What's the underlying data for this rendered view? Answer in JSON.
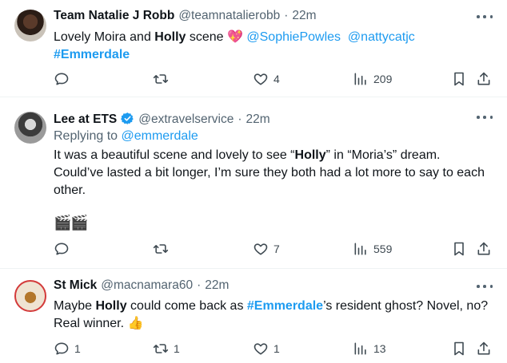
{
  "tweets": [
    {
      "name": "Team Natalie J Robb",
      "handle": "@teamnatalierobb",
      "time": "22m",
      "text_parts": [
        "Lovely Moira and ",
        "Holly",
        " scene ",
        "💖",
        " ",
        "@SophiePowles",
        "  ",
        "@nattycatjc"
      ],
      "hashtag_line": "#Emmerdale",
      "counts": {
        "reply": "",
        "retweet": "",
        "like": "4",
        "views": "209"
      }
    },
    {
      "name": "Lee at ETS",
      "handle": "@extravelservice",
      "time": "22m",
      "verified": true,
      "replying_label": "Replying to ",
      "replying_to": "@emmerdale",
      "text_a": "It was a beautiful scene and lovely to see “",
      "text_b": "Holly",
      "text_c": "” in “Moria’s” dream.",
      "text_d": "Could’ve lasted a bit longer, I’m sure they both had a lot more to say to each",
      "text_e": "other.",
      "emoji_line": "🎬🎬",
      "counts": {
        "reply": "",
        "retweet": "",
        "like": "7",
        "views": "559"
      }
    },
    {
      "name": "St Mick",
      "handle": "@macnamara60",
      "time": "22m",
      "text_a": "Maybe ",
      "text_b": "Holly",
      "text_c": " could come back as ",
      "text_hashtag": "#Emmerdale",
      "text_d": "’s resident ghost? Novel, no?",
      "text_e": "Real winner. ",
      "emoji": "👍",
      "counts": {
        "reply": "1",
        "retweet": "1",
        "like": "1",
        "views": "13"
      }
    }
  ],
  "colors": {
    "accent": "#1d9bf0",
    "muted": "#536471",
    "text": "#0f1419"
  },
  "icons": [
    "reply-icon",
    "retweet-icon",
    "like-icon",
    "views-icon",
    "bookmark-icon",
    "share-icon",
    "more-icon",
    "verified-icon"
  ]
}
